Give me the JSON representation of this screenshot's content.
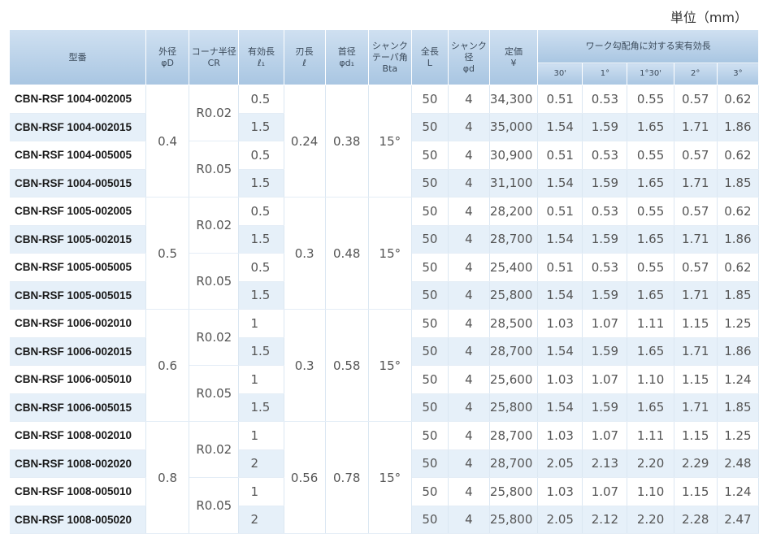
{
  "unit_label": "単位（mm）",
  "headers": {
    "model": "型番",
    "outer": [
      "外径",
      "φD"
    ],
    "corner": [
      "コーナ半径",
      "CR"
    ],
    "effective": [
      "有効長",
      "ℓ₁"
    ],
    "blade": [
      "刃長",
      "ℓ"
    ],
    "neck": [
      "首径",
      "φd₁"
    ],
    "taper": [
      "シャンク",
      "テーパ角",
      "Bta"
    ],
    "total": [
      "全長",
      "L"
    ],
    "shank": [
      "シャンク径",
      "φd"
    ],
    "price": [
      "定価",
      "¥"
    ],
    "work": "ワーク勾配角に対する実有効長",
    "angles": [
      "30'",
      "1°",
      "1°30'",
      "2°",
      "3°"
    ]
  },
  "groups": [
    {
      "outer": "0.4",
      "blade": "0.24",
      "neck": "0.38",
      "taper": "15°",
      "corners": [
        {
          "cr": "R0.02",
          "rows": [
            {
              "model": "CBN-RSF 1004-002005",
              "eff": "0.5",
              "L": "50",
              "d": "4",
              "price": "34,300",
              "vals": [
                "0.51",
                "0.53",
                "0.55",
                "0.57",
                "0.62"
              ]
            },
            {
              "model": "CBN-RSF 1004-002015",
              "eff": "1.5",
              "L": "50",
              "d": "4",
              "price": "35,000",
              "vals": [
                "1.54",
                "1.59",
                "1.65",
                "1.71",
                "1.86"
              ]
            }
          ]
        },
        {
          "cr": "R0.05",
          "rows": [
            {
              "model": "CBN-RSF 1004-005005",
              "eff": "0.5",
              "L": "50",
              "d": "4",
              "price": "30,900",
              "vals": [
                "0.51",
                "0.53",
                "0.55",
                "0.57",
                "0.62"
              ]
            },
            {
              "model": "CBN-RSF 1004-005015",
              "eff": "1.5",
              "L": "50",
              "d": "4",
              "price": "31,100",
              "vals": [
                "1.54",
                "1.59",
                "1.65",
                "1.71",
                "1.85"
              ]
            }
          ]
        }
      ]
    },
    {
      "outer": "0.5",
      "blade": "0.3",
      "neck": "0.48",
      "taper": "15°",
      "corners": [
        {
          "cr": "R0.02",
          "rows": [
            {
              "model": "CBN-RSF 1005-002005",
              "eff": "0.5",
              "L": "50",
              "d": "4",
              "price": "28,200",
              "vals": [
                "0.51",
                "0.53",
                "0.55",
                "0.57",
                "0.62"
              ]
            },
            {
              "model": "CBN-RSF 1005-002015",
              "eff": "1.5",
              "L": "50",
              "d": "4",
              "price": "28,700",
              "vals": [
                "1.54",
                "1.59",
                "1.65",
                "1.71",
                "1.86"
              ]
            }
          ]
        },
        {
          "cr": "R0.05",
          "rows": [
            {
              "model": "CBN-RSF 1005-005005",
              "eff": "0.5",
              "L": "50",
              "d": "4",
              "price": "25,400",
              "vals": [
                "0.51",
                "0.53",
                "0.55",
                "0.57",
                "0.62"
              ]
            },
            {
              "model": "CBN-RSF 1005-005015",
              "eff": "1.5",
              "L": "50",
              "d": "4",
              "price": "25,800",
              "vals": [
                "1.54",
                "1.59",
                "1.65",
                "1.71",
                "1.85"
              ]
            }
          ]
        }
      ]
    },
    {
      "outer": "0.6",
      "blade": "0.3",
      "neck": "0.58",
      "taper": "15°",
      "corners": [
        {
          "cr": "R0.02",
          "rows": [
            {
              "model": "CBN-RSF 1006-002010",
              "eff": "1",
              "L": "50",
              "d": "4",
              "price": "28,500",
              "vals": [
                "1.03",
                "1.07",
                "1.11",
                "1.15",
                "1.25"
              ]
            },
            {
              "model": "CBN-RSF 1006-002015",
              "eff": "1.5",
              "L": "50",
              "d": "4",
              "price": "28,700",
              "vals": [
                "1.54",
                "1.59",
                "1.65",
                "1.71",
                "1.86"
              ]
            }
          ]
        },
        {
          "cr": "R0.05",
          "rows": [
            {
              "model": "CBN-RSF 1006-005010",
              "eff": "1",
              "L": "50",
              "d": "4",
              "price": "25,600",
              "vals": [
                "1.03",
                "1.07",
                "1.10",
                "1.15",
                "1.24"
              ]
            },
            {
              "model": "CBN-RSF 1006-005015",
              "eff": "1.5",
              "L": "50",
              "d": "4",
              "price": "25,800",
              "vals": [
                "1.54",
                "1.59",
                "1.65",
                "1.71",
                "1.85"
              ]
            }
          ]
        }
      ]
    },
    {
      "outer": "0.8",
      "blade": "0.56",
      "neck": "0.78",
      "taper": "15°",
      "corners": [
        {
          "cr": "R0.02",
          "rows": [
            {
              "model": "CBN-RSF 1008-002010",
              "eff": "1",
              "L": "50",
              "d": "4",
              "price": "28,700",
              "vals": [
                "1.03",
                "1.07",
                "1.11",
                "1.15",
                "1.25"
              ]
            },
            {
              "model": "CBN-RSF 1008-002020",
              "eff": "2",
              "L": "50",
              "d": "4",
              "price": "28,700",
              "vals": [
                "2.05",
                "2.13",
                "2.20",
                "2.29",
                "2.48"
              ]
            }
          ]
        },
        {
          "cr": "R0.05",
          "rows": [
            {
              "model": "CBN-RSF 1008-005010",
              "eff": "1",
              "L": "50",
              "d": "4",
              "price": "25,800",
              "vals": [
                "1.03",
                "1.07",
                "1.10",
                "1.15",
                "1.24"
              ]
            },
            {
              "model": "CBN-RSF 1008-005020",
              "eff": "2",
              "L": "50",
              "d": "4",
              "price": "25,800",
              "vals": [
                "2.05",
                "2.12",
                "2.20",
                "2.28",
                "2.47"
              ]
            }
          ]
        }
      ]
    }
  ]
}
